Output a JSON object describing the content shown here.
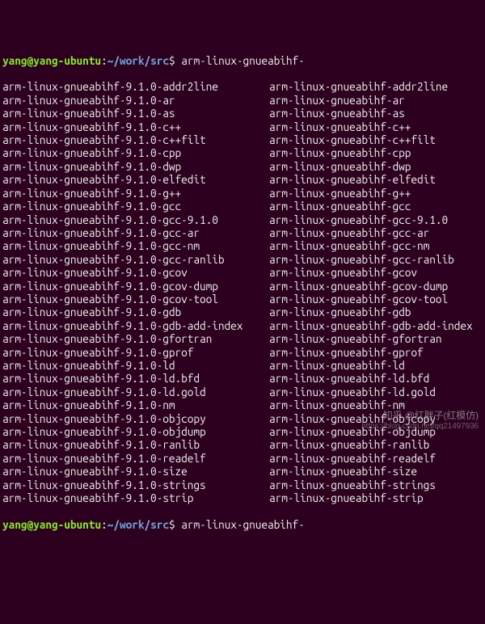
{
  "prompt1": {
    "user": "yang",
    "at": "@",
    "host": "yang-ubuntu",
    "colon": ":",
    "path": "~/work/src",
    "dollar": "$ ",
    "cmd": "arm-linux-gnueabihf-"
  },
  "prompt2": {
    "user": "yang",
    "at": "@",
    "host": "yang-ubuntu",
    "colon": ":",
    "path": "~/work/src",
    "dollar": "$ ",
    "cmd": "arm-linux-gnueabihf-"
  },
  "listing": {
    "left": [
      "arm-linux-gnueabihf-9.1.0-addr2line",
      "arm-linux-gnueabihf-9.1.0-ar",
      "arm-linux-gnueabihf-9.1.0-as",
      "arm-linux-gnueabihf-9.1.0-c++",
      "arm-linux-gnueabihf-9.1.0-c++filt",
      "arm-linux-gnueabihf-9.1.0-cpp",
      "arm-linux-gnueabihf-9.1.0-dwp",
      "arm-linux-gnueabihf-9.1.0-elfedit",
      "arm-linux-gnueabihf-9.1.0-g++",
      "arm-linux-gnueabihf-9.1.0-gcc",
      "arm-linux-gnueabihf-9.1.0-gcc-9.1.0",
      "arm-linux-gnueabihf-9.1.0-gcc-ar",
      "arm-linux-gnueabihf-9.1.0-gcc-nm",
      "arm-linux-gnueabihf-9.1.0-gcc-ranlib",
      "arm-linux-gnueabihf-9.1.0-gcov",
      "arm-linux-gnueabihf-9.1.0-gcov-dump",
      "arm-linux-gnueabihf-9.1.0-gcov-tool",
      "arm-linux-gnueabihf-9.1.0-gdb",
      "arm-linux-gnueabihf-9.1.0-gdb-add-index",
      "arm-linux-gnueabihf-9.1.0-gfortran",
      "arm-linux-gnueabihf-9.1.0-gprof",
      "arm-linux-gnueabihf-9.1.0-ld",
      "arm-linux-gnueabihf-9.1.0-ld.bfd",
      "arm-linux-gnueabihf-9.1.0-ld.gold",
      "arm-linux-gnueabihf-9.1.0-nm",
      "arm-linux-gnueabihf-9.1.0-objcopy",
      "arm-linux-gnueabihf-9.1.0-objdump",
      "arm-linux-gnueabihf-9.1.0-ranlib",
      "arm-linux-gnueabihf-9.1.0-readelf",
      "arm-linux-gnueabihf-9.1.0-size",
      "arm-linux-gnueabihf-9.1.0-strings",
      "arm-linux-gnueabihf-9.1.0-strip"
    ],
    "right": [
      "arm-linux-gnueabihf-addr2line",
      "arm-linux-gnueabihf-ar",
      "arm-linux-gnueabihf-as",
      "arm-linux-gnueabihf-c++",
      "arm-linux-gnueabihf-c++filt",
      "arm-linux-gnueabihf-cpp",
      "arm-linux-gnueabihf-dwp",
      "arm-linux-gnueabihf-elfedit",
      "arm-linux-gnueabihf-g++",
      "arm-linux-gnueabihf-gcc",
      "arm-linux-gnueabihf-gcc-9.1.0",
      "arm-linux-gnueabihf-gcc-ar",
      "arm-linux-gnueabihf-gcc-nm",
      "arm-linux-gnueabihf-gcc-ranlib",
      "arm-linux-gnueabihf-gcov",
      "arm-linux-gnueabihf-gcov-dump",
      "arm-linux-gnueabihf-gcov-tool",
      "arm-linux-gnueabihf-gdb",
      "arm-linux-gnueabihf-gdb-add-index",
      "arm-linux-gnueabihf-gfortran",
      "arm-linux-gnueabihf-gprof",
      "arm-linux-gnueabihf-ld",
      "arm-linux-gnueabihf-ld.bfd",
      "arm-linux-gnueabihf-ld.gold",
      "arm-linux-gnueabihf-nm",
      "arm-linux-gnueabihf-objcopy",
      "arm-linux-gnueabihf-objdump",
      "arm-linux-gnueabihf-ranlib",
      "arm-linux-gnueabihf-readelf",
      "arm-linux-gnueabihf-size",
      "arm-linux-gnueabihf-strings",
      "arm-linux-gnueabihf-strip"
    ]
  },
  "watermark": {
    "line1": "知乎 @红胖子(红模仿)",
    "line2": "https://blog.csdn.net/qq21497936"
  }
}
